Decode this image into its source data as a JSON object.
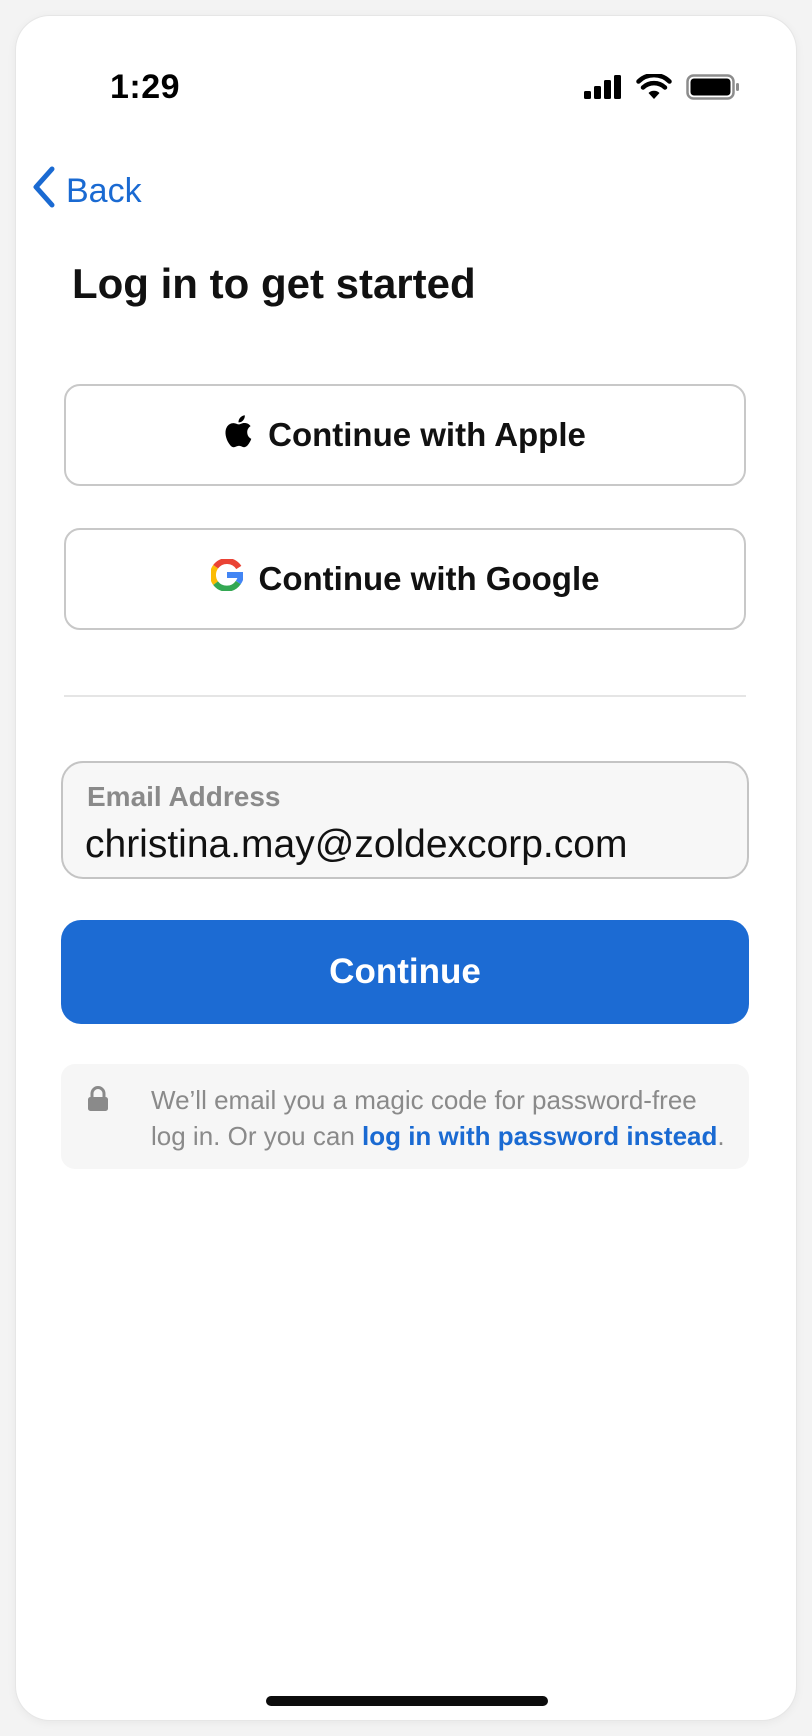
{
  "status_bar": {
    "time": "1:29",
    "icons": [
      "cellular-signal-icon",
      "wifi-icon",
      "battery-icon"
    ]
  },
  "nav": {
    "back_label": "Back",
    "back_icon": "chevron-left-icon"
  },
  "page": {
    "title": "Log in to get started"
  },
  "social": {
    "apple_label": "Continue with Apple",
    "apple_icon": "apple-logo-icon",
    "google_label": "Continue with Google",
    "google_icon": "google-logo-icon"
  },
  "email": {
    "label": "Email Address",
    "value": "christina.may@zoldexcorp.com"
  },
  "continue_label": "Continue",
  "info": {
    "icon": "lock-icon",
    "text": "We’ll email you a magic code for password-free log in. Or you can ",
    "link": "log in with password instead",
    "suffix": "."
  },
  "colors": {
    "accent": "#1c6bd3",
    "link": "#1a6ad2",
    "muted_text": "#8a8a8a",
    "border": "#c8c8c8"
  }
}
